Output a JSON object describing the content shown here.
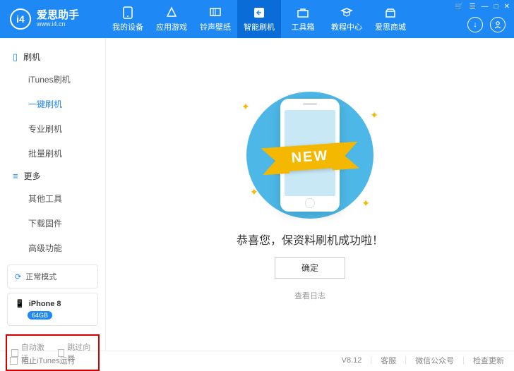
{
  "header": {
    "logo_text": "i4",
    "title": "爱思助手",
    "subtitle": "www.i4.cn",
    "nav": [
      {
        "label": "我的设备"
      },
      {
        "label": "应用游戏"
      },
      {
        "label": "铃声壁纸"
      },
      {
        "label": "智能刷机",
        "active": true
      },
      {
        "label": "工具箱"
      },
      {
        "label": "教程中心"
      },
      {
        "label": "爱思商城"
      }
    ]
  },
  "sidebar": {
    "group1": {
      "title": "刷机",
      "items": [
        "iTunes刷机",
        "一键刷机",
        "专业刷机",
        "批量刷机"
      ],
      "active_index": 1
    },
    "group2": {
      "title": "更多",
      "items": [
        "其他工具",
        "下载固件",
        "高级功能"
      ]
    },
    "mode": "正常模式",
    "device": {
      "name": "iPhone 8",
      "storage": "64GB"
    },
    "checks": {
      "auto_activate": "自动激活",
      "skip_guide": "跳过向导"
    }
  },
  "main": {
    "ribbon": "NEW",
    "success": "恭喜您，保资料刷机成功啦！",
    "ok": "确定",
    "log": "查看日志"
  },
  "footer": {
    "block_itunes": "阻止iTunes运行",
    "version": "V8.12",
    "links": [
      "客服",
      "微信公众号",
      "检查更新"
    ]
  }
}
